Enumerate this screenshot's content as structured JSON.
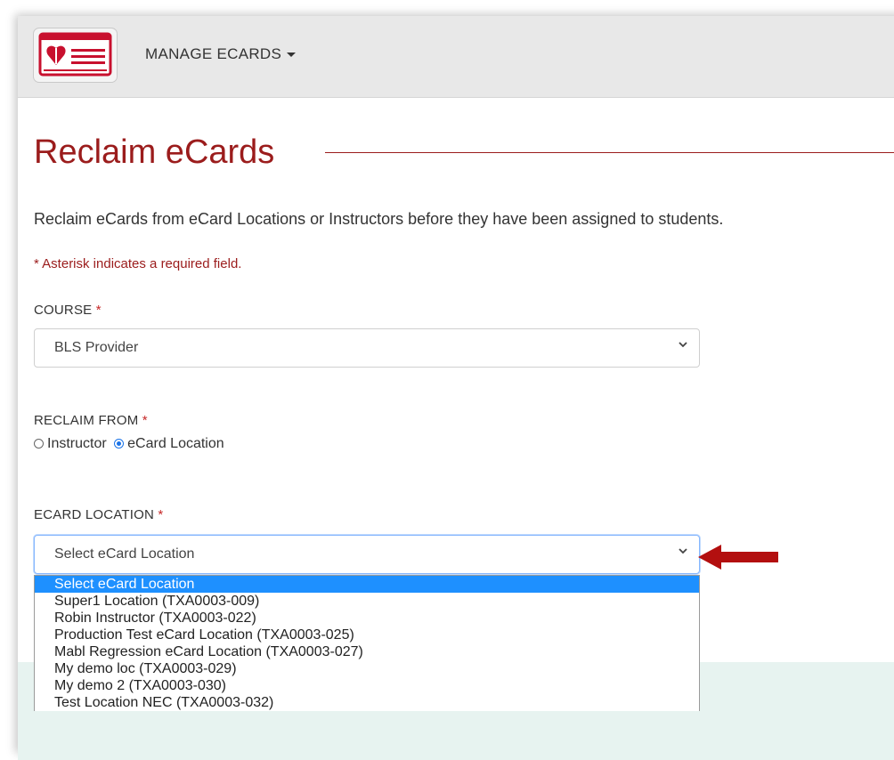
{
  "nav": {
    "menu_label": "MANAGE ECARDS"
  },
  "page": {
    "title": "Reclaim eCards",
    "intro": "Reclaim eCards from eCard Locations or Instructors before they have been assigned to students.",
    "required_note": "* Asterisk indicates a required field."
  },
  "course": {
    "label": "COURSE",
    "required_mark": "*",
    "value": "BLS Provider"
  },
  "reclaim_from": {
    "label": "RECLAIM FROM",
    "required_mark": "*",
    "options": [
      {
        "label": "Instructor",
        "selected": false
      },
      {
        "label": "eCard Location",
        "selected": true
      }
    ]
  },
  "ecard_location": {
    "label": "ECARD LOCATION",
    "required_mark": "*",
    "value": "Select eCard Location",
    "options": [
      "Select eCard Location",
      "Super1 Location (TXA0003-009)",
      "Robin Instructor (TXA0003-022)",
      "Production Test eCard Location (TXA0003-025)",
      "Mabl Regression eCard Location (TXA0003-027)",
      "My demo loc (TXA0003-029)",
      "My demo 2 (TXA0003-030)",
      "Test Location NEC (TXA0003-032)"
    ],
    "highlighted_index": 0
  },
  "icons": {
    "logo": "aha-ecard-logo-icon",
    "dropdown": "chevron-down-icon",
    "annotation": "red-arrow-icon"
  },
  "colors": {
    "accent": "#9b1c1c",
    "selection": "#1e90ff",
    "arrow": "#b30f0f"
  }
}
